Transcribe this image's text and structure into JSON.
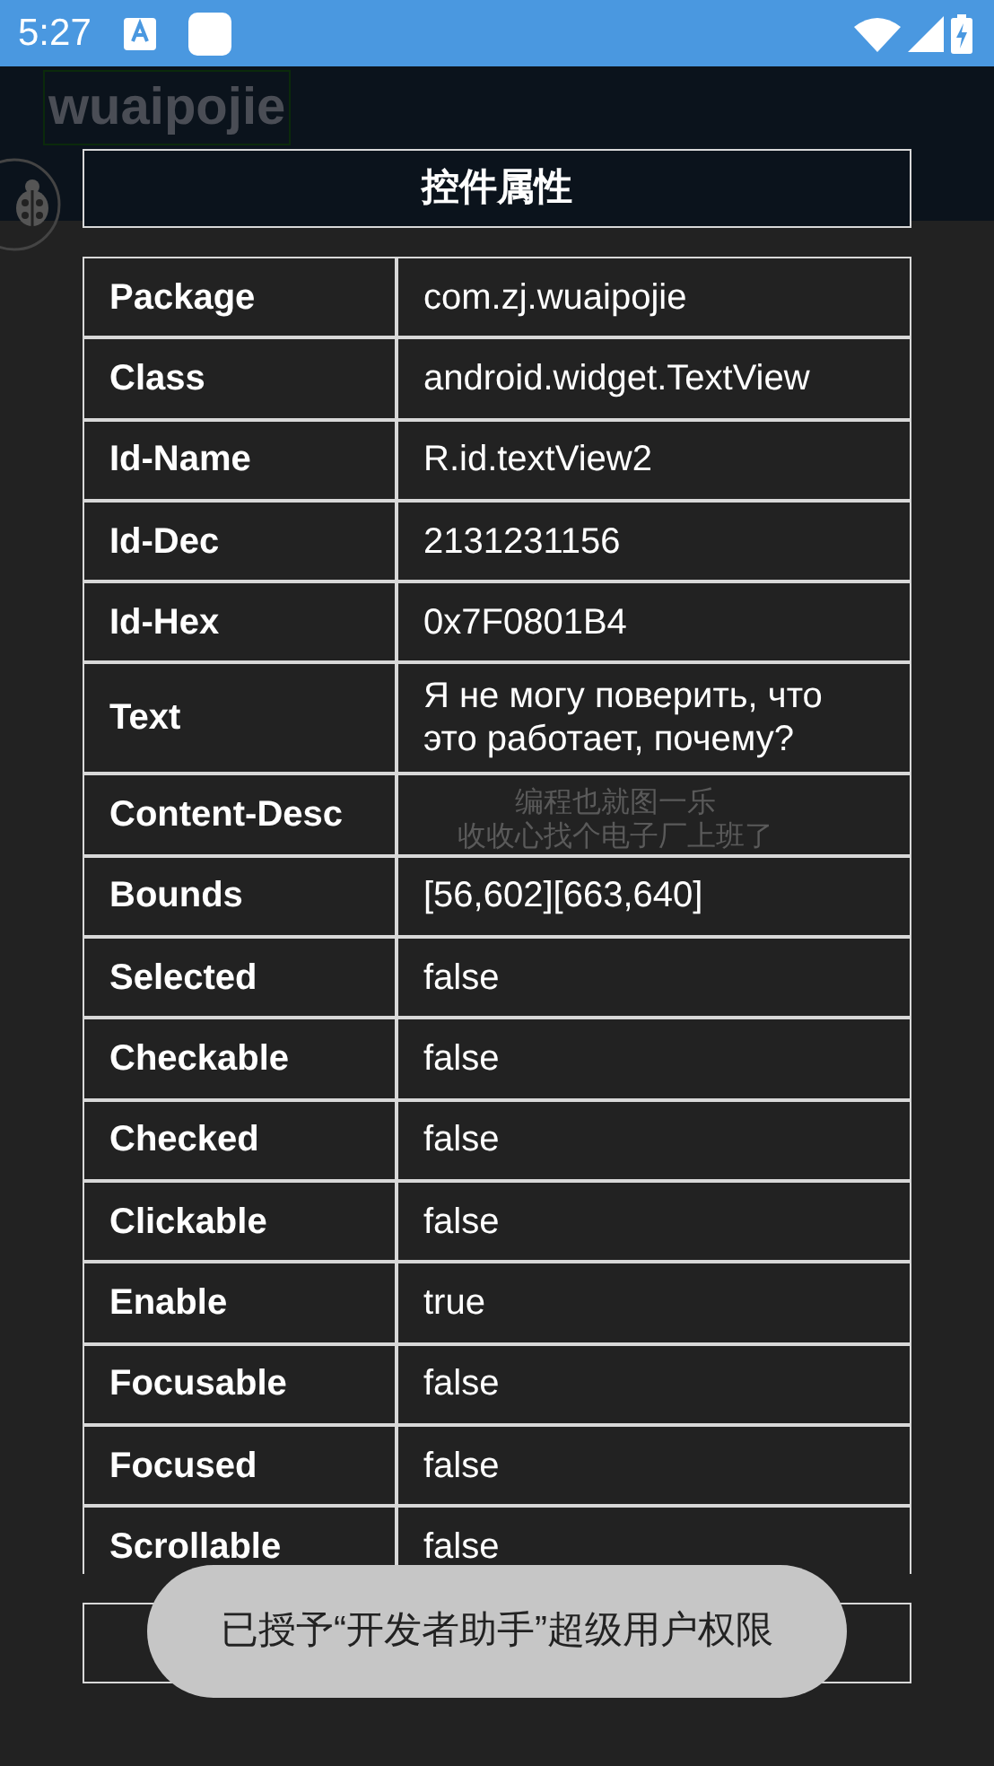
{
  "status_bar": {
    "time": "5:27"
  },
  "app": {
    "title": "wuaipojie",
    "lines": [
      "编程也就图一乐",
      "收收心找个电子厂上班了"
    ]
  },
  "dialog": {
    "title": "控件属性",
    "rows": [
      {
        "label": "Package",
        "value": "com.zj.wuaipojie"
      },
      {
        "label": "Class",
        "value": "android.widget.TextView"
      },
      {
        "label": "Id-Name",
        "value": "R.id.textView2"
      },
      {
        "label": "Id-Dec",
        "value": "2131231156"
      },
      {
        "label": "Id-Hex",
        "value": "0x7F0801B4"
      },
      {
        "label": "Text",
        "value": "Я не могу поверить, что это работает, почему?"
      },
      {
        "label": "Content-Desc"
      },
      {
        "label": "Bounds",
        "value": "[56,602][663,640]"
      },
      {
        "label": "Selected",
        "value": "false"
      },
      {
        "label": "Checkable",
        "value": "false"
      },
      {
        "label": "Checked",
        "value": "false"
      },
      {
        "label": "Clickable",
        "value": "false"
      },
      {
        "label": "Enable",
        "value": "true"
      },
      {
        "label": "Focusable",
        "value": "false"
      },
      {
        "label": "Focused",
        "value": "false"
      },
      {
        "label": "Scrollable",
        "value": "false"
      }
    ]
  },
  "toast": "已授予“开发者助手”超级用户权限"
}
